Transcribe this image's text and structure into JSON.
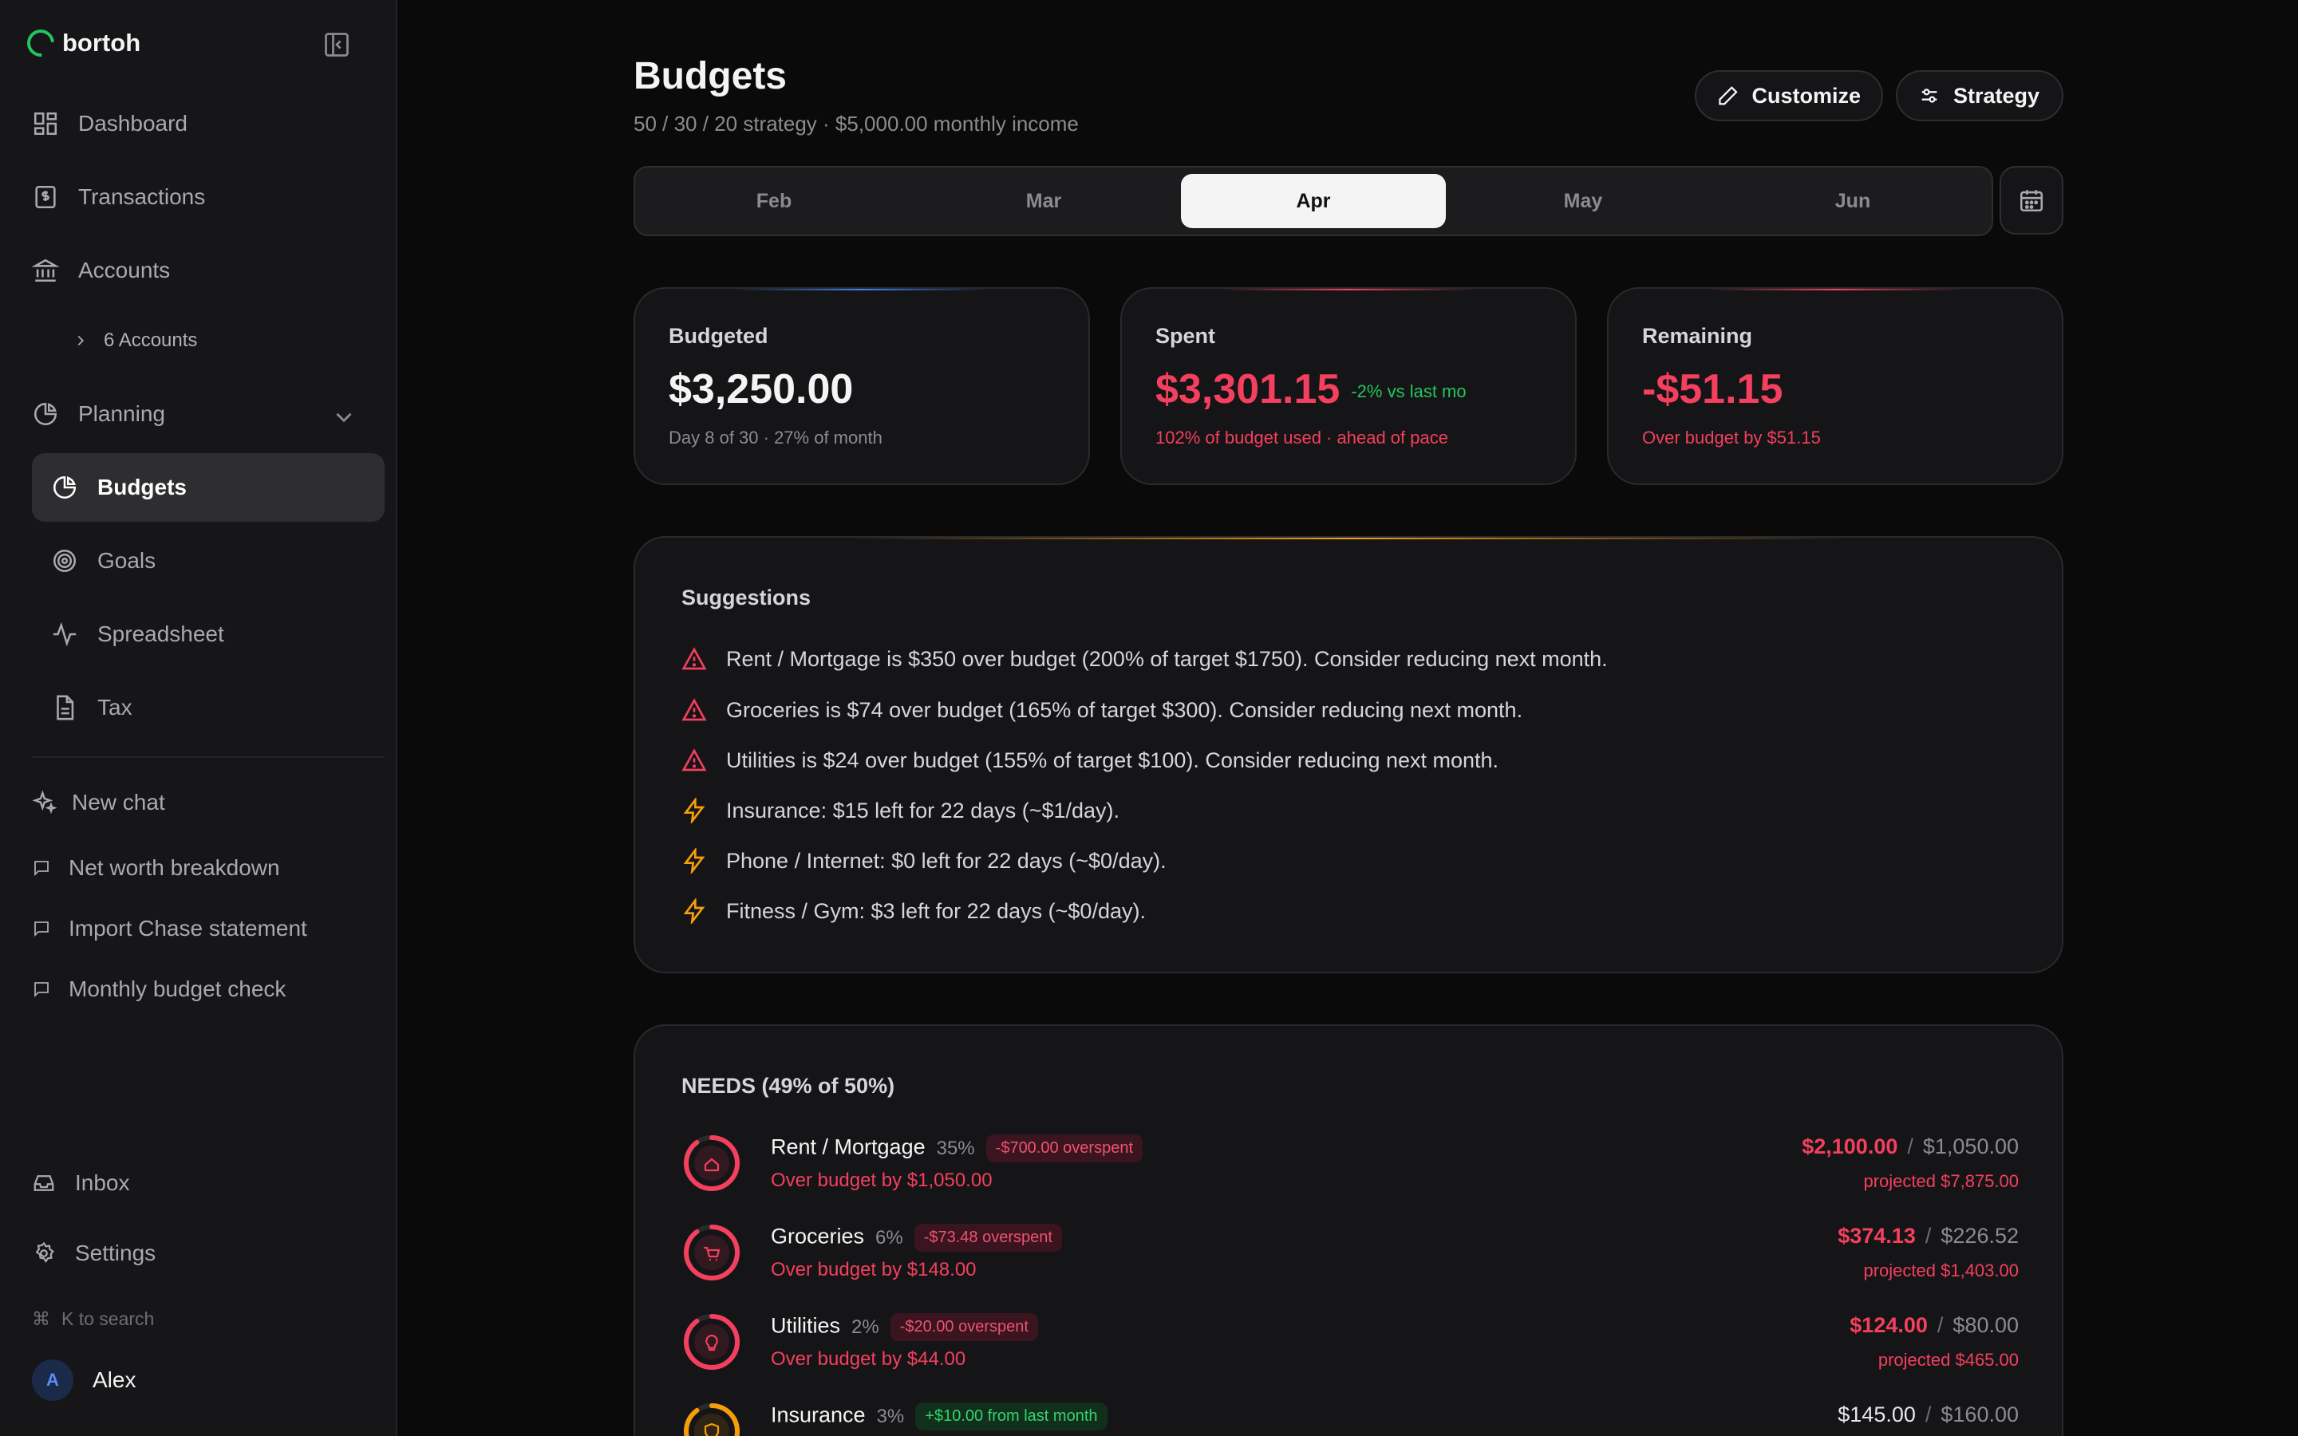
{
  "app": {
    "name": "bortoh"
  },
  "sidebar": {
    "nav": [
      {
        "label": "Dashboard",
        "icon": "dashboard-icon"
      },
      {
        "label": "Transactions",
        "icon": "receipt-icon"
      },
      {
        "label": "Accounts",
        "icon": "bank-icon"
      }
    ],
    "accounts_sub": "6 Accounts",
    "planning": {
      "label": "Planning",
      "items": [
        {
          "label": "Budgets",
          "icon": "pie-chart-icon",
          "active": true
        },
        {
          "label": "Goals",
          "icon": "target-icon",
          "active": false
        },
        {
          "label": "Spreadsheet",
          "icon": "activity-icon",
          "active": false
        },
        {
          "label": "Tax",
          "icon": "document-icon",
          "active": false
        }
      ]
    },
    "new_chat": "New chat",
    "chats": [
      "Net worth breakdown",
      "Import Chase statement",
      "Monthly budget check"
    ],
    "inbox": "Inbox",
    "settings": "Settings",
    "search_hint": "K to search",
    "user": {
      "initial": "A",
      "name": "Alex"
    }
  },
  "header": {
    "title": "Budgets",
    "subtitle": "50 / 30 / 20 strategy · $5,000.00 monthly income",
    "customize_label": "Customize",
    "strategy_label": "Strategy"
  },
  "months": {
    "items": [
      "Feb",
      "Mar",
      "Apr",
      "May",
      "Jun"
    ],
    "selected": "Apr"
  },
  "stats": {
    "budgeted": {
      "label": "Budgeted",
      "value": "$3,250.00",
      "note": "Day 8 of 30 · 27% of month"
    },
    "spent": {
      "label": "Spent",
      "value": "$3,301.15",
      "delta": "-2% vs last mo",
      "note": "102% of budget used · ahead of pace"
    },
    "remaining": {
      "label": "Remaining",
      "value": "-$51.15",
      "note": "Over budget by $51.15"
    }
  },
  "suggestions": {
    "title": "Suggestions",
    "items": [
      {
        "type": "warning",
        "text": "Rent / Mortgage is $350 over budget (200% of target $1750). Consider reducing next month."
      },
      {
        "type": "warning",
        "text": "Groceries is $74 over budget (165% of target $300). Consider reducing next month."
      },
      {
        "type": "warning",
        "text": "Utilities is $24 over budget (155% of target $100). Consider reducing next month."
      },
      {
        "type": "bolt",
        "text": "Insurance: $15 left for 22 days (~$1/day)."
      },
      {
        "type": "bolt",
        "text": "Phone / Internet: $0 left for 22 days (~$0/day)."
      },
      {
        "type": "bolt",
        "text": "Fitness / Gym: $3 left for 22 days (~$0/day)."
      }
    ]
  },
  "needs": {
    "title": "NEEDS (49% of 50%)",
    "rows": [
      {
        "name": "Rent / Mortgage",
        "pct": "35%",
        "badge": "-$700.00 overspent",
        "badge_type": "red",
        "sub": "Over budget by $1,050.00",
        "spent": "$2,100.00",
        "target": "$1,050.00",
        "projected": "projected $7,875.00",
        "icon": "home-icon",
        "ring_color": "#f43f5e",
        "fill": 0.9
      },
      {
        "name": "Groceries",
        "pct": "6%",
        "badge": "-$73.48 overspent",
        "badge_type": "red",
        "sub": "Over budget by $148.00",
        "spent": "$374.13",
        "target": "$226.52",
        "projected": "projected $1,403.00",
        "icon": "cart-icon",
        "ring_color": "#f43f5e",
        "fill": 0.9
      },
      {
        "name": "Utilities",
        "pct": "2%",
        "badge": "-$20.00 overspent",
        "badge_type": "red",
        "sub": "Over budget by $44.00",
        "spent": "$124.00",
        "target": "$80.00",
        "projected": "projected $465.00",
        "icon": "bulb-icon",
        "ring_color": "#f43f5e",
        "fill": 0.9
      },
      {
        "name": "Insurance",
        "pct": "3%",
        "badge": "+$10.00 from last month",
        "badge_type": "green",
        "sub": "",
        "spent": "$145.00",
        "target": "$160.00",
        "projected": "",
        "icon": "shield-icon",
        "ring_color": "#f59e0b",
        "fill": 0.9
      }
    ]
  },
  "colors": {
    "accent": "#22c55e",
    "danger": "#f43f5e",
    "warning": "#f59e0b"
  }
}
